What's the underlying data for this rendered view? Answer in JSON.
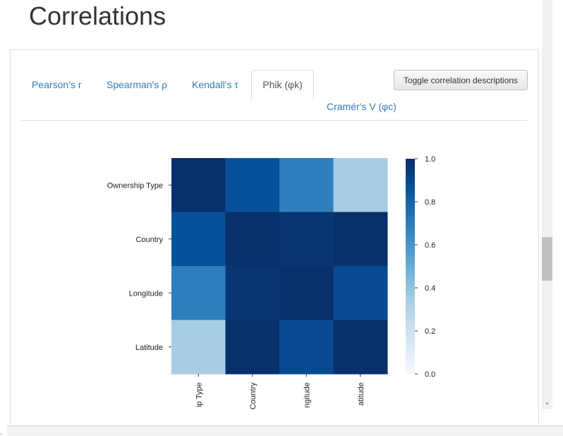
{
  "page": {
    "title": "Correlations"
  },
  "tabs": [
    {
      "label": "Pearson's r",
      "active": false
    },
    {
      "label": "Spearman's ρ",
      "active": false
    },
    {
      "label": "Kendall's τ",
      "active": false
    },
    {
      "label": "Phik (φk)",
      "active": true
    },
    {
      "label": "Cramér's V (φc)",
      "active": false
    }
  ],
  "toggle_button": {
    "label": "Toggle correlation descriptions"
  },
  "chart_data": {
    "type": "heatmap",
    "rows": [
      "Ownership Type",
      "Country",
      "Longitude",
      "Latitude"
    ],
    "columns": [
      "ip Type",
      "Country",
      "ngitude",
      "atitude"
    ],
    "values": [
      [
        1.0,
        0.88,
        0.7,
        0.35
      ],
      [
        0.88,
        1.0,
        0.98,
        1.0
      ],
      [
        0.7,
        0.98,
        1.0,
        0.9
      ],
      [
        0.35,
        1.0,
        0.9,
        1.0
      ]
    ],
    "colorbar": {
      "min": 0.0,
      "max": 1.0,
      "ticks": [
        "0.0",
        "0.2",
        "0.4",
        "0.6",
        "0.8",
        "1.0"
      ]
    },
    "colormap": "Blues"
  },
  "scrollbar": {
    "down_arrow": "⌄"
  },
  "footer": {
    "mark": ","
  }
}
